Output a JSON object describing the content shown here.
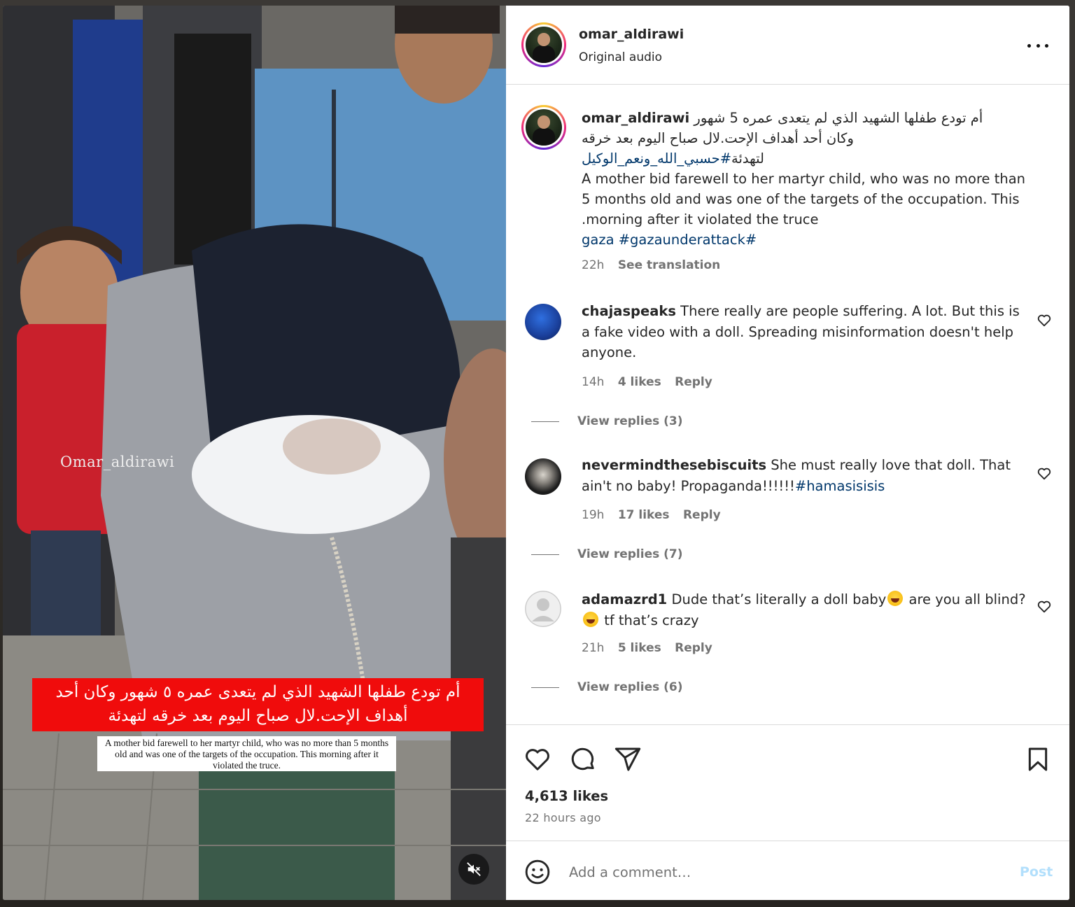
{
  "post": {
    "username": "omar_aldirawi",
    "audio": "Original audio",
    "caption": {
      "username": "omar_aldirawi",
      "arabic_line1": "أم تودع طفلها الشهيد الذي لم يتعدى عمره 5 شهور",
      "arabic_line2": "وكان أحد أهداف الإحت.لال صباح اليوم بعد خرقه",
      "arabic_line3": "لتهدئة",
      "arabic_hashtag": "#حسبي_الله_ونعم_الوكيل",
      "english_line1": "A mother bid farewell to her martyr child, who was no more than",
      "english_line2": "5 months old and was one of the targets of the occupation. This",
      "english_line3": ".morning after it violated the truce",
      "hashtags": "gaza #gazaunderattack#",
      "time": "22h",
      "see_translation": "See translation"
    },
    "likes": "4,613 likes",
    "time_ago": "22 hours ago"
  },
  "media": {
    "watermark": "Omar_aldirawi",
    "arabic_overlay": "أم تودع طفلها الشهيد الذي لم يتعدى عمره ٥ شهور وكان أحد أهداف الإحت.لال صباح اليوم بعد خرقه لتهدئة",
    "english_overlay": "A mother bid farewell to her martyr child, who was no more than 5 months old and was one of the targets of the occupation. This morning after it violated the truce."
  },
  "comments": [
    {
      "username": "chajaspeaks",
      "text": "There really are people suffering. A lot. But this is a fake video with a doll. Spreading misinformation doesn't help anyone.",
      "time": "14h",
      "likes": "4 likes",
      "reply": "Reply",
      "view_replies": "View replies (3)"
    },
    {
      "username": "nevermindthesebiscuits",
      "text": "She must really love that doll. That ain't no baby! Propaganda!!!!!!",
      "hashtag": "#hamasisisis",
      "time": "19h",
      "likes": "17 likes",
      "reply": "Reply",
      "view_replies": "View replies (7)"
    },
    {
      "username": "adamazrd1",
      "text_a": "Dude that’s literally a doll baby",
      "text_b": " are you all blind?",
      "text_c": " tf that’s crazy",
      "time": "21h",
      "likes": "5 likes",
      "reply": "Reply",
      "view_replies": "View replies (6)"
    }
  ],
  "composer": {
    "placeholder": "Add a comment…",
    "post_label": "Post"
  },
  "icons": [
    "more-horizontal-icon",
    "heart-icon",
    "comment-icon",
    "share-icon",
    "bookmark-icon",
    "emoji-icon",
    "mute-icon"
  ],
  "colors": {
    "link": "#00376b",
    "muted": "#737373",
    "post_button_disabled": "#b2dffc",
    "overlay_red": "#f00c0c"
  }
}
